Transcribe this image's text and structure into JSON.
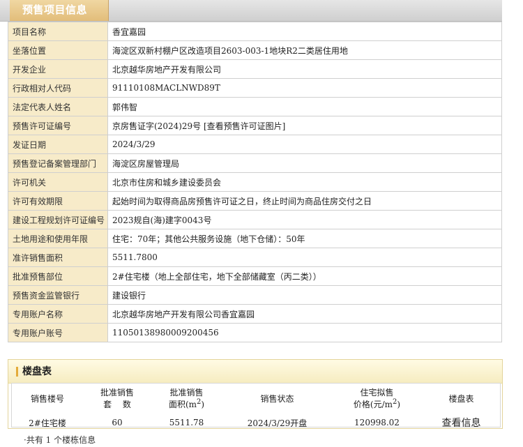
{
  "tab": {
    "label": "预售项目信息"
  },
  "info_rows": [
    {
      "key": "项目名称",
      "value": "香宜嘉园"
    },
    {
      "key": "坐落位置",
      "value": "海淀区双新村棚户区改造项目2603-003-1地块R2二类居住用地"
    },
    {
      "key": "开发企业",
      "value": "北京越华房地产开发有限公司"
    },
    {
      "key": "行政相对人代码",
      "value": "91110108MACLNWD89T"
    },
    {
      "key": "法定代表人姓名",
      "value": "郭伟智"
    },
    {
      "key": "预售许可证编号",
      "value": "京房售证字(2024)29号 [查看预售许可证图片]"
    },
    {
      "key": "发证日期",
      "value": "2024/3/29"
    },
    {
      "key": "预售登记备案管理部门",
      "value": "海淀区房屋管理局"
    },
    {
      "key": "许可机关",
      "value": "北京市住房和城乡建设委员会"
    },
    {
      "key": "许可有效期限",
      "value": "起始时间为取得商品房预售许可证之日，终止时间为商品住房交付之日"
    },
    {
      "key": "建设工程规划许可证编号",
      "value": "2023规自(海)建字0043号"
    },
    {
      "key": "土地用途和使用年限",
      "value": "住宅：70年；其他公共服务设施（地下仓储）：50年"
    },
    {
      "key": "准许销售面积",
      "value": "5511.7800"
    },
    {
      "key": "批准预售部位",
      "value": "2#住宅楼（地上全部住宅，地下全部储藏室（丙二类））"
    },
    {
      "key": "预售资金监管银行",
      "value": "建设银行"
    },
    {
      "key": "专用账户名称",
      "value": "北京越华房地产开发有限公司香宜嘉园"
    },
    {
      "key": "专用账户账号",
      "value": "11050138980009200456"
    }
  ],
  "building_table": {
    "title": "楼盘表",
    "headers": {
      "building_no": "销售楼号",
      "approved_units_line1": "批准销售",
      "approved_units_line2": "套　 数",
      "approved_area_line1": "批准销售",
      "approved_area_line2_prefix": "面积(m",
      "approved_area_sup": "2",
      "approved_area_line2_suffix": ")",
      "sale_status": "销售状态",
      "price_line1": "住宅拟售",
      "price_line2_prefix": "价格(元/m",
      "price_sup": "2",
      "price_line2_suffix": ")",
      "floor_table": "楼盘表"
    },
    "rows": [
      {
        "building_no": "2#住宅楼",
        "units": "60",
        "area": "5511.78",
        "status": "2024/3/29开盘",
        "price": "120998.02",
        "link": "查看信息"
      }
    ]
  },
  "footer": {
    "text": "·共有 1 个楼栋信息"
  }
}
